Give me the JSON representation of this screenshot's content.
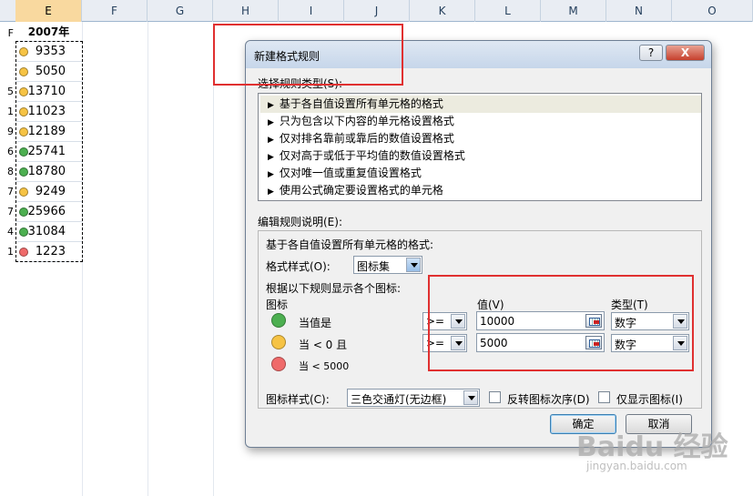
{
  "sheet": {
    "columns": [
      "E",
      "F",
      "G",
      "H",
      "I",
      "J",
      "K",
      "L",
      "M",
      "N",
      "O"
    ],
    "selected_column": "E",
    "header_cell": "2007年",
    "rows": [
      {
        "value": "9353",
        "light": "yellow",
        "stub": ""
      },
      {
        "value": "5050",
        "light": "yellow",
        "stub": ""
      },
      {
        "value": "13710",
        "light": "yellow",
        "stub": "5"
      },
      {
        "value": "11023",
        "light": "yellow",
        "stub": "1"
      },
      {
        "value": "12189",
        "light": "yellow",
        "stub": "9"
      },
      {
        "value": "25741",
        "light": "green",
        "stub": "6"
      },
      {
        "value": "18780",
        "light": "green",
        "stub": "8"
      },
      {
        "value": "9249",
        "light": "yellow",
        "stub": "7"
      },
      {
        "value": "25966",
        "light": "green",
        "stub": "7"
      },
      {
        "value": "31084",
        "light": "green",
        "stub": "4"
      },
      {
        "value": "1223",
        "light": "red",
        "stub": "1"
      }
    ],
    "first_stub": "F",
    "colors": {
      "green": "#4caf50",
      "yellow": "#f6c344",
      "red": "#ef6a6a",
      "selected_col": "#f9d99f"
    }
  },
  "dialog": {
    "title": "新建格式规则",
    "help_label": "?",
    "close_label": "X",
    "rule_type_label": "选择规则类型(S):",
    "rule_types": [
      "基于各自值设置所有单元格的格式",
      "只为包含以下内容的单元格设置格式",
      "仅对排名靠前或靠后的数值设置格式",
      "仅对高于或低于平均值的数值设置格式",
      "仅对唯一值或重复值设置格式",
      "使用公式确定要设置格式的单元格"
    ],
    "edit_label": "编辑规则说明(E):",
    "desc_title": "基于各自值设置所有单元格的格式:",
    "format_style_label": "格式样式(O):",
    "format_style_value": "图标集",
    "display_rule_label": "根据以下规则显示各个图标:",
    "icon_col_label": "图标",
    "value_col_label": "值(V)",
    "type_col_label": "类型(T)",
    "conditions": [
      {
        "text": "当值是",
        "operator": ">=",
        "value": "10000",
        "type": "数字",
        "color": "#4caf50"
      },
      {
        "text": "当 < 0 且",
        "operator": ">=",
        "value": "5000",
        "type": "数字",
        "color": "#f6c344"
      },
      {
        "text": "当 < 5000",
        "color": "#ef6a6a"
      }
    ],
    "icon_style_label": "图标样式(C):",
    "icon_style_value": "三色交通灯(无边框)",
    "reverse_label": "反转图标次序(D)",
    "show_icon_only_label": "仅显示图标(I)",
    "ok_label": "确定",
    "cancel_label": "取消"
  },
  "watermark": {
    "text": "Baidu 经验",
    "sub": "jingyan.baidu.com"
  }
}
